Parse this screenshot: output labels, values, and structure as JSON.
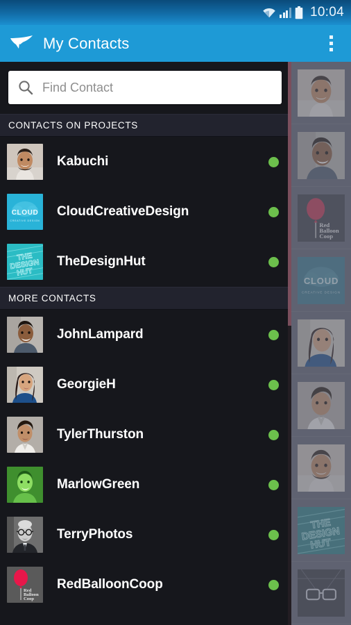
{
  "status_bar": {
    "time": "10:04",
    "icons": {
      "wifi": "wifi-icon",
      "signal": "signal-icon",
      "battery": "battery-icon"
    }
  },
  "app_bar": {
    "title": "My Contacts",
    "logo": "bird-logo-icon",
    "overflow": "overflow-menu-icon"
  },
  "search": {
    "placeholder": "Find Contact",
    "value": "",
    "icon": "search-icon"
  },
  "sections": [
    {
      "header": "CONTACTS ON PROJECTS",
      "contacts": [
        {
          "name": "Kabuchi",
          "avatar": "photo-man-smiling",
          "status": "online",
          "status_color": "#6cbf4c"
        },
        {
          "name": "CloudCreativeDesign",
          "avatar": "logo-cloud",
          "status": "online",
          "status_color": "#6cbf4c"
        },
        {
          "name": "TheDesignHut",
          "avatar": "logo-design-hut",
          "status": "online",
          "status_color": "#6cbf4c"
        }
      ]
    },
    {
      "header": "MORE CONTACTS",
      "contacts": [
        {
          "name": "JohnLampard",
          "avatar": "photo-man-grey",
          "status": "online",
          "status_color": "#6cbf4c"
        },
        {
          "name": "GeorgieH",
          "avatar": "photo-woman",
          "status": "online",
          "status_color": "#6cbf4c"
        },
        {
          "name": "TylerThurston",
          "avatar": "photo-man-shirt",
          "status": "online",
          "status_color": "#6cbf4c"
        },
        {
          "name": "MarlowGreen",
          "avatar": "photo-man-green",
          "status": "online",
          "status_color": "#6cbf4c"
        },
        {
          "name": "TerryPhotos",
          "avatar": "photo-man-glasses-bw",
          "status": "online",
          "status_color": "#6cbf4c"
        },
        {
          "name": "RedBalloonCoop",
          "avatar": "logo-red-balloon",
          "status": "online",
          "status_color": "#6cbf4c"
        }
      ]
    }
  ],
  "side_drawer": {
    "items": [
      {
        "avatar": "photo-man-smiling"
      },
      {
        "avatar": "photo-man-grey"
      },
      {
        "avatar": "logo-red-balloon"
      },
      {
        "avatar": "logo-cloud"
      },
      {
        "avatar": "photo-woman"
      },
      {
        "avatar": "photo-man-shirt"
      },
      {
        "avatar": "photo-man-smiling-2"
      },
      {
        "avatar": "logo-design-hut"
      },
      {
        "avatar": "logo-glasses"
      }
    ]
  },
  "colors": {
    "accent": "#1e9ad6",
    "status_bar_top": "#0a4a7a",
    "list_background": "#16171c",
    "section_background": "#22232e",
    "online_dot": "#6cbf4c",
    "scrollbar": "#8a5766",
    "drawer_background": "#5e6170"
  }
}
